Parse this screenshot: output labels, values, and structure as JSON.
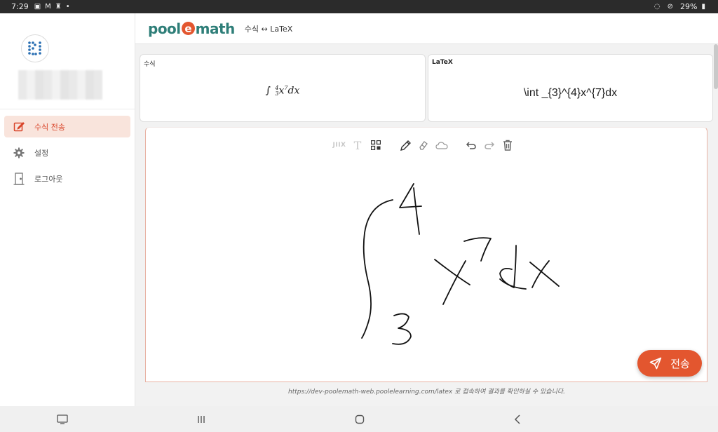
{
  "status_bar": {
    "time": "7:29",
    "battery": "29%",
    "icons": [
      "photo-icon",
      "gmail-icon",
      "keyhole-icon",
      "dot-icon"
    ],
    "right_icons": [
      "wifi-off-icon",
      "do-not-disturb-icon"
    ]
  },
  "sidebar": {
    "avatar_icon": "poole-logo-icon",
    "items": [
      {
        "label": "수식 전송",
        "icon": "edit-icon",
        "active": true
      },
      {
        "label": "설정",
        "icon": "gear-icon",
        "active": false
      },
      {
        "label": "로그아웃",
        "icon": "door-icon",
        "active": false
      }
    ]
  },
  "header": {
    "logo_parts": [
      "pool",
      "e",
      "math"
    ],
    "subtitle": "수식 ↔ LaTeX"
  },
  "formula_card": {
    "label": "수식",
    "integral_sign": "∫",
    "lower": "3",
    "upper": "4",
    "base": "x",
    "exponent": "7",
    "tail": "dx"
  },
  "latex_card": {
    "label": "LaTeX",
    "value": "\\int _{3}^{4}x^{7}dx"
  },
  "canvas": {
    "toolbar": {
      "jiix": "JIIX",
      "text_tool": "T"
    }
  },
  "send_button": {
    "label": "전송"
  },
  "footer_note": "https://dev-poolemath-web.poolelearning.com/latex 로 접속하여 결과를 확인하실 수 있습니다.",
  "colors": {
    "accent": "#e3562f",
    "brand": "#2e7e78",
    "active_bg": "#f9e4dc"
  }
}
